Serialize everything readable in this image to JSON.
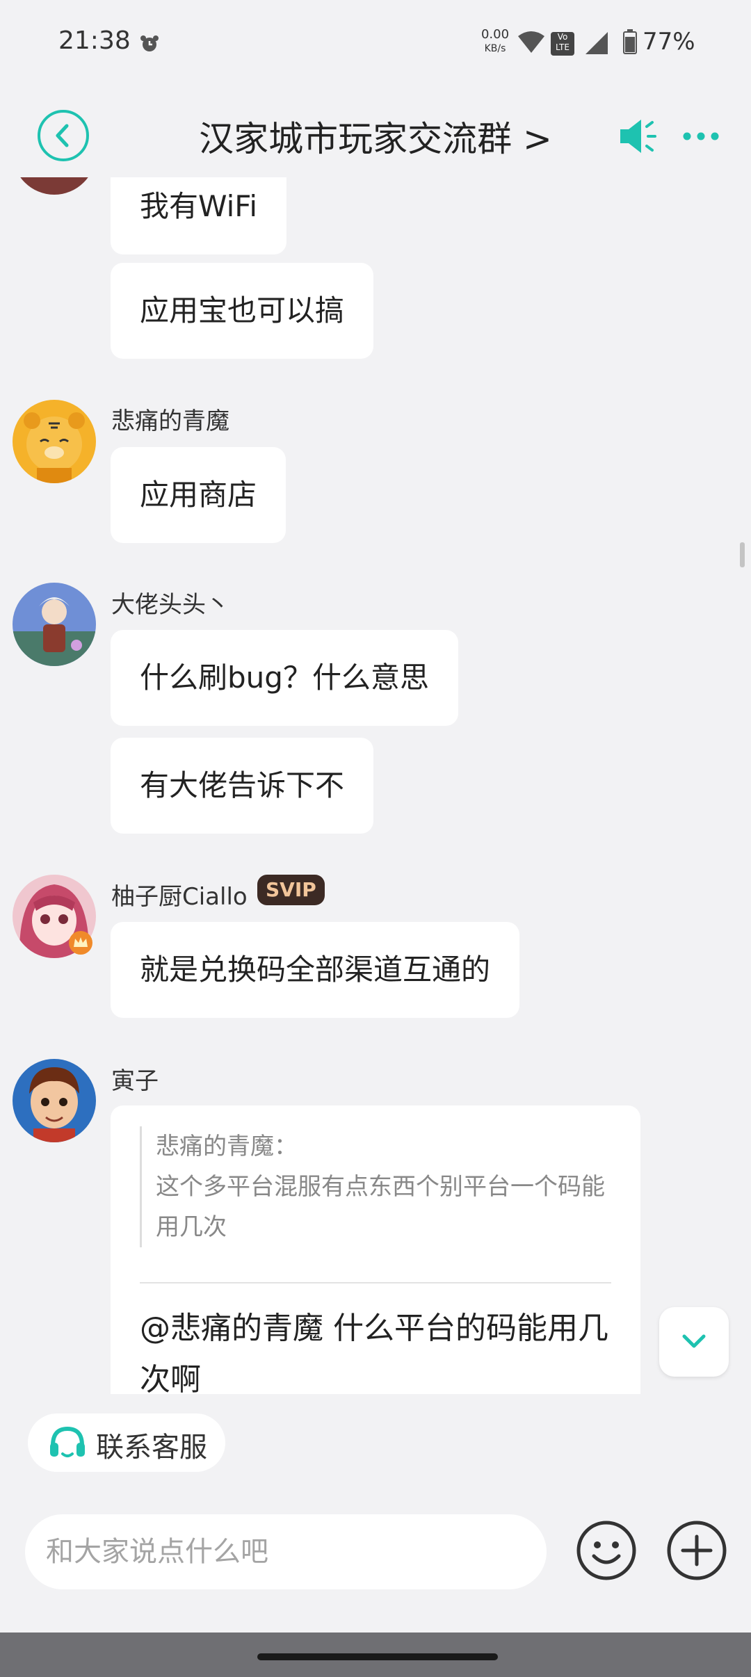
{
  "status_bar": {
    "time": "21:38",
    "net_speed_value": "0.00",
    "net_speed_unit": "KB/s",
    "volte_label": "Vo\nLTE",
    "battery": "77%"
  },
  "header": {
    "title": "汉家城市玩家交流群 >"
  },
  "messages": [
    {
      "text": "我有WiFi"
    },
    {
      "text": "应用宝也可以搞"
    },
    {
      "sender": "悲痛的青魔",
      "text": "应用商店"
    },
    {
      "sender": "大佬头头丶",
      "text": "什么刷bug？什么意思"
    },
    {
      "text": "有大佬告诉下不"
    },
    {
      "sender": "柚子厨Ciallo",
      "badge": "SVIP",
      "text": "就是兑换码全部渠道互通的"
    },
    {
      "sender": "寅子",
      "quote_author": "悲痛的青魔：",
      "quote_text": "这个多平台混服有点东西个别平台一个码能用几次",
      "text": "@悲痛的青魔 什么平台的码能用几次啊"
    }
  ],
  "contact_service": {
    "label": "联系客服"
  },
  "input": {
    "placeholder": "和大家说点什么吧"
  },
  "colors": {
    "accent": "#1ec2b0",
    "background": "#f2f2f4",
    "svip_bg": "#3c2a24",
    "svip_text": "#f2c59a"
  },
  "icons": {
    "back": "chevron-left-circle-icon",
    "speaker": "speaker-icon",
    "more": "more-dots-icon",
    "scroll_down": "chevron-down-icon",
    "headset": "headset-icon",
    "emoji": "smiley-icon",
    "plus": "plus-circle-icon"
  }
}
